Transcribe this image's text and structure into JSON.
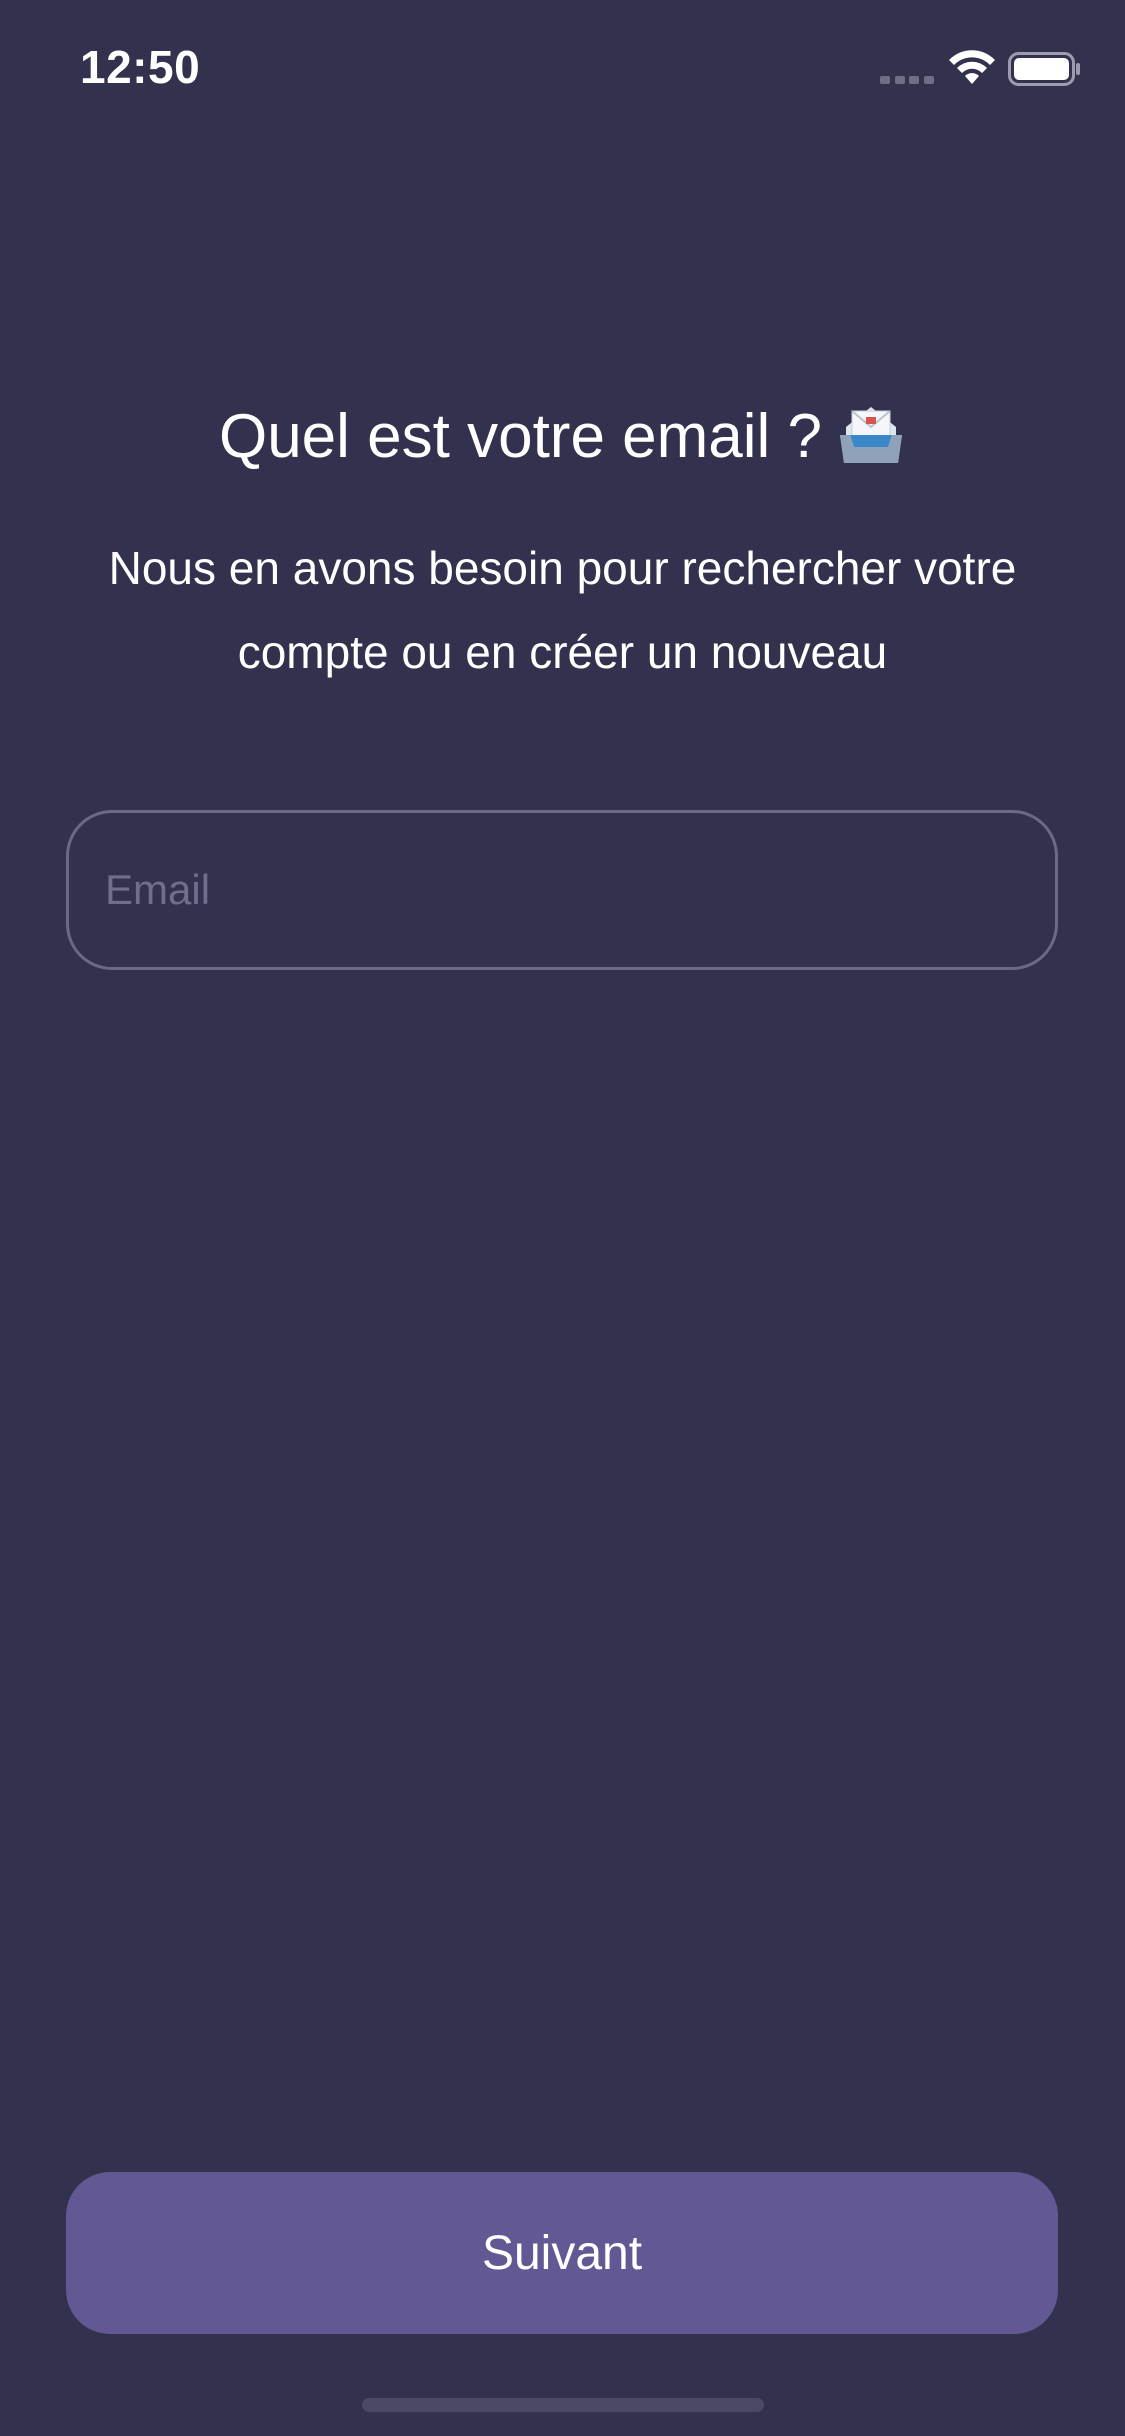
{
  "status_bar": {
    "time": "12:50",
    "icons": [
      "cellular-signal-icon",
      "wifi-icon",
      "battery-icon"
    ]
  },
  "screen": {
    "title": "Quel est votre email ?",
    "title_emoji": "inbox-tray-envelope-icon",
    "subtitle": "Nous en avons besoin pour rechercher votre compte ou en créer un nouveau"
  },
  "form": {
    "email_value": "",
    "email_placeholder": "Email"
  },
  "actions": {
    "next_label": "Suivant"
  },
  "colors": {
    "background": "#33324e",
    "button": "#625893",
    "field_border": "#6a6988",
    "placeholder": "#6f6e8c"
  }
}
